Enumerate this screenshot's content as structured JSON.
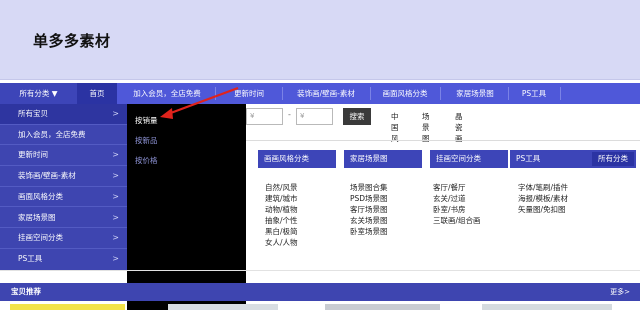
{
  "shop": {
    "title": "单多多素材"
  },
  "navbar": {
    "all_categories": "所有分类 ▼",
    "items": [
      "首页",
      "加入会员，全店免费",
      "更新时间",
      "装饰画/壁画-素材",
      "画面风格分类",
      "家居场景图",
      "PS工具"
    ]
  },
  "sidemenu": {
    "items": [
      "所有宝贝",
      "加入会员，全店免费",
      "更新时间",
      "装饰画/壁画-素材",
      "画面风格分类",
      "家居场景图",
      "挂画空间分类",
      "PS工具"
    ],
    "chevron": ">"
  },
  "submenu": {
    "items": [
      "按销量",
      "按新品",
      "按价格"
    ]
  },
  "filter": {
    "currency": "¥",
    "dash": "-",
    "search_label": "搜索",
    "tags": [
      "中国风",
      "场景图",
      "晶瓷画"
    ]
  },
  "categories": {
    "headers": [
      "画画风格分类",
      "家居场景图",
      "挂画空间分类",
      "PS工具"
    ],
    "all_label": "所有分类",
    "columns": [
      [
        "自然/风景",
        "建筑/城市",
        "动物/植物",
        "抽象/个性",
        "黑白/极简",
        "女人/人物"
      ],
      [
        "场景图合集",
        "PSD场景图",
        "客厅场景图",
        "玄关场景图",
        "卧室场景图"
      ],
      [
        "客厅/餐厅",
        "玄关/过道",
        "卧室/书房",
        "三联画/组合画"
      ],
      [
        "字体/笔刷/插件",
        "海报/模板/素材",
        "矢量图/免扣图"
      ]
    ]
  },
  "recommend": {
    "title": "宝贝推荐",
    "more": "更多>"
  },
  "colors": {
    "banner": "#d7d9f5",
    "nav": "#4f58d9",
    "sidebar": "#3e45b0",
    "submenu": "#000000",
    "arrow": "#e0231c"
  }
}
